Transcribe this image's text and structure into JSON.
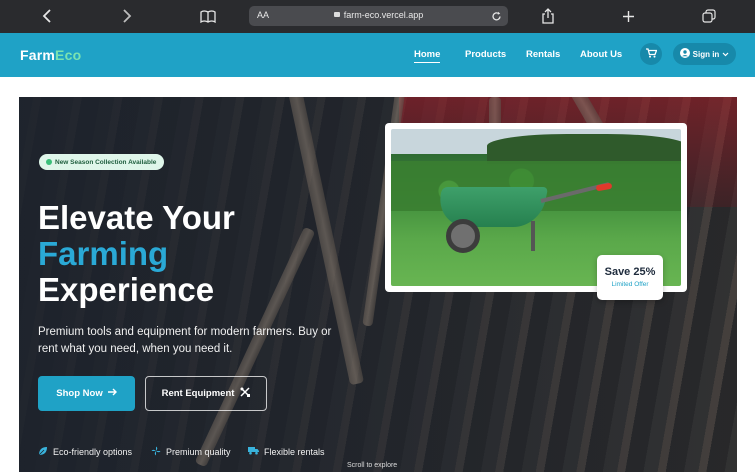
{
  "browser": {
    "text_size_label": "AA",
    "url": "farm-eco.vercel.app"
  },
  "nav": {
    "brand_part1": "Farm",
    "brand_part2": "Eco",
    "links": [
      "Home",
      "Products",
      "Rentals",
      "About Us"
    ],
    "active_link": "Home",
    "signin_label": "Sign in"
  },
  "hero": {
    "badge": "New Season Collection Available",
    "title_line1": "Elevate Your",
    "title_line2": "Farming",
    "title_line3": "Experience",
    "subtitle": "Premium tools and equipment for modern farmers. Buy or rent what you need, when you need it.",
    "primary_button": "Shop Now",
    "secondary_button": "Rent Equipment",
    "features": [
      "Eco-friendly options",
      "Premium quality",
      "Flexible rentals"
    ],
    "scroll_hint": "Scroll to explore"
  },
  "promo": {
    "title": "Save 25%",
    "subtitle": "Limited Offer"
  },
  "colors": {
    "brand": "#1fa2c6",
    "accent_green": "#7be3b0",
    "hero_overlay": "#1c222c"
  },
  "icons": [
    "back-icon",
    "forward-icon",
    "bookmarks-icon",
    "reload-icon",
    "share-icon",
    "new-tab-icon",
    "tabs-icon",
    "cart-icon",
    "user-icon",
    "chevron-down-icon",
    "arrow-right-icon",
    "tools-icon",
    "leaf-icon",
    "fan-icon",
    "truck-icon"
  ]
}
